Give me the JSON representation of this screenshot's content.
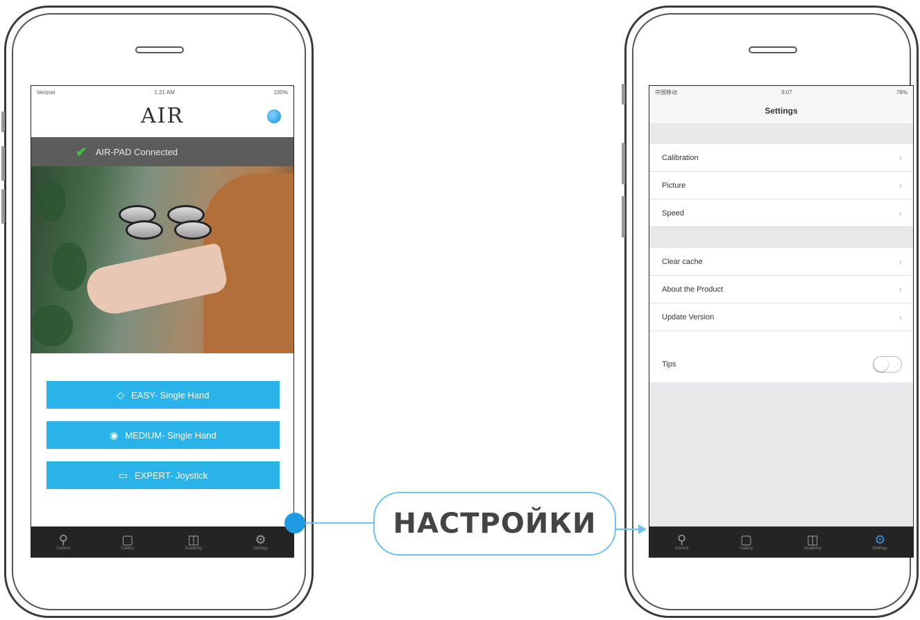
{
  "left_phone": {
    "status": {
      "carrier": "Verizon",
      "time": "1:21 AM",
      "battery": "100%"
    },
    "logo": "AIR",
    "connection": {
      "text": "AIR-PAD Connected"
    },
    "modes": [
      {
        "label": "EASY- Single Hand",
        "icon": "◇"
      },
      {
        "label": "MEDIUM- Single Hand",
        "icon": "◉"
      },
      {
        "label": "EXPERT- Joystick",
        "icon": "▭"
      }
    ],
    "tabs": [
      {
        "label": "Control",
        "icon": "⚲"
      },
      {
        "label": "Gallery",
        "icon": "▢"
      },
      {
        "label": "Academy",
        "icon": "◫"
      },
      {
        "label": "Settings",
        "icon": "⚙"
      }
    ]
  },
  "right_phone": {
    "status": {
      "carrier": "中国移动",
      "time": "9:07",
      "battery": "78%"
    },
    "title": "Settings",
    "group1": [
      "Calibration",
      "Picture",
      "Speed"
    ],
    "group2": [
      "Clear cache",
      "About the Product",
      "Update Version"
    ],
    "tips_label": "Tips",
    "tabs": [
      {
        "label": "Control",
        "icon": "⚲"
      },
      {
        "label": "Gallery",
        "icon": "▢"
      },
      {
        "label": "Academy",
        "icon": "◫"
      },
      {
        "label": "Settings",
        "icon": "⚙"
      }
    ]
  },
  "callout": {
    "label": "НАСТРОЙКИ",
    "color": "#1e9be0"
  },
  "colors": {
    "accent": "#2ab3e8",
    "tabbar": "#242424",
    "connected_bar": "#5c5c5c"
  }
}
